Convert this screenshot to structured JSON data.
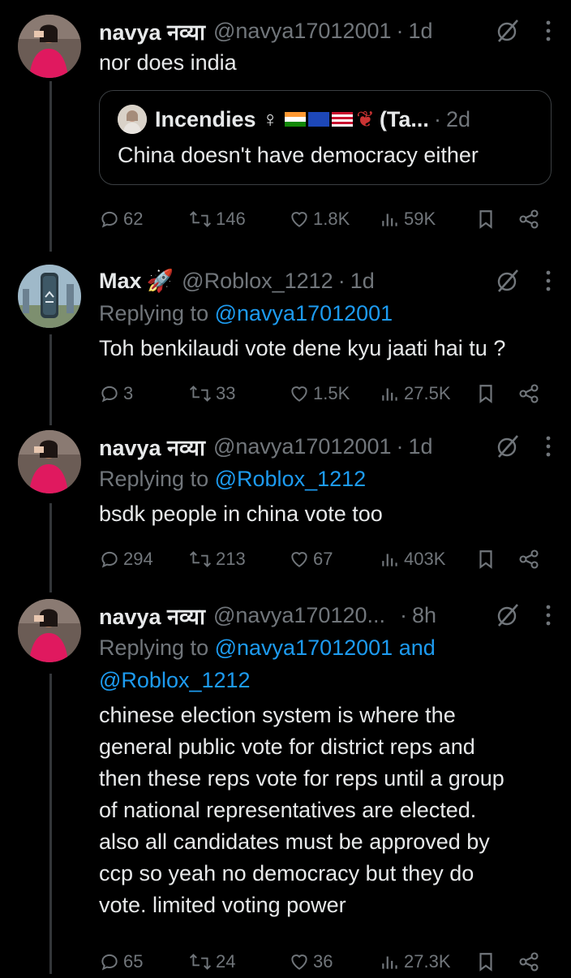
{
  "tweets": [
    {
      "name": "navya नव्या",
      "handle": "@navya17012001",
      "time": "1d",
      "text": "nor does india",
      "quote": {
        "name": "Incendies ♀",
        "name_suffix": "(Ta...",
        "time": "2d",
        "text": "China doesn't have democracy either"
      },
      "stats": {
        "replies": "62",
        "retweets": "146",
        "likes": "1.8K",
        "views": "59K"
      }
    },
    {
      "name": "Max",
      "handle": "@Roblox_1212",
      "time": "1d",
      "reply_prefix": "Replying to",
      "reply_to": "@navya17012001",
      "text": "Toh benkilaudi vote dene kyu jaati hai tu ?",
      "stats": {
        "replies": "3",
        "retweets": "33",
        "likes": "1.5K",
        "views": "27.5K"
      }
    },
    {
      "name": "navya नव्या",
      "handle": "@navya17012001",
      "time": "1d",
      "reply_prefix": "Replying to",
      "reply_to": "@Roblox_1212",
      "text": "bsdk people in china vote too",
      "stats": {
        "replies": "294",
        "retweets": "213",
        "likes": "67",
        "views": "403K"
      }
    },
    {
      "name": "navya नव्या",
      "handle": "@navya170120...",
      "time": "8h",
      "reply_prefix": "Replying to",
      "reply_to": "@navya17012001 and",
      "reply_to_2": "@Roblox_1212",
      "text_lines": [
        "chinese election system is where the",
        "general public vote for district reps and",
        "then these reps vote for reps until a group",
        "of national representatives are elected.",
        "also all candidates must be approved by",
        "ccp so yeah no democracy but they do",
        "vote. limited voting power"
      ],
      "stats": {
        "replies": "65",
        "retweets": "24",
        "likes": "36",
        "views": "27.3K"
      }
    }
  ],
  "colors": {
    "bg": "#000000",
    "text": "#e7e9ea",
    "muted": "#71767b",
    "link": "#1d9bf0",
    "border": "#3b3f42"
  },
  "icons": [
    "reply-icon",
    "retweet-icon",
    "like-icon",
    "views-icon",
    "bookmark-icon",
    "share-icon",
    "grok-icon",
    "more-icon",
    "rocket-emoji"
  ]
}
